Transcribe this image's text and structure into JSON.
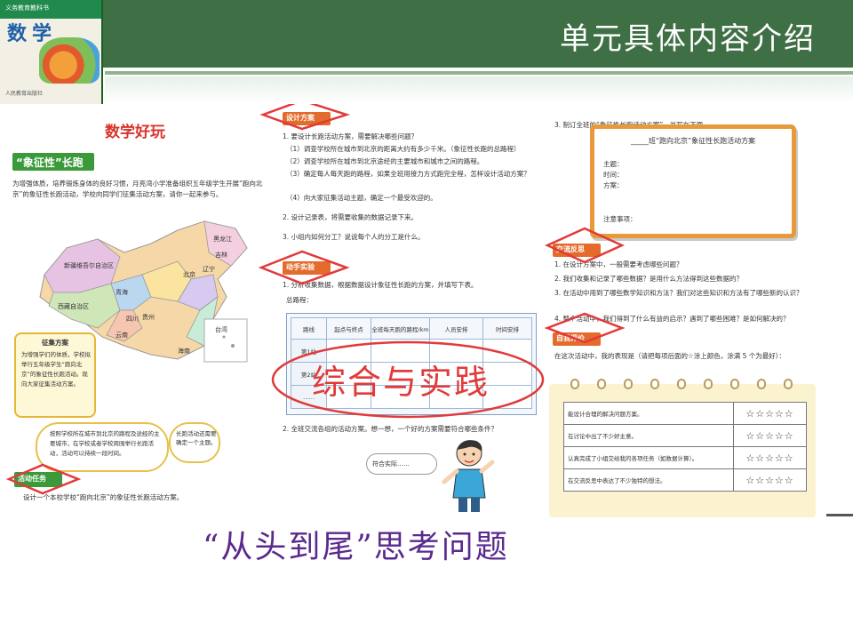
{
  "header": {
    "title": "单元具体内容介绍"
  },
  "cover": {
    "publisher_line": "义务教育教科书",
    "title": "数学",
    "bottom_line": "人民教育出版社"
  },
  "left_page": {
    "title": "数学好玩",
    "subtitle": "“象征性”长跑",
    "intro": "为增强体质，培养锻炼身体的良好习惯，月亮湾小学准备组织五年级学生开展“跑向北京”的象征性长跑活动，学校向同学们征集活动方案，请你一起来参与。",
    "map_labels": [
      "新疆维吾尔自治区",
      "西藏自治区",
      "青海",
      "四川",
      "云南",
      "贵州",
      "黑龙江",
      "吉林",
      "辽宁",
      "北京",
      "台湾",
      "海南"
    ],
    "note_title": "征集方案",
    "note_text": "为增强学们的体质，学校拟举行五年级学生“跑向北京”的象征性长跑活动。现向大家征集活动方案。",
    "cloud1_text": "按照学校所在城市到北京的路程及途经的主要城市，在学校或者学校周围举行长跑活动，活动可以持续一段时间。",
    "cloud2_text": "长跑活动还需要确定一个主题。",
    "task_label": "活动任务",
    "task_text": "设计一个本校学校“跑向北京”的象征性长跑活动方案。"
  },
  "middle_page": {
    "design_label": "设计方案",
    "design_items": [
      "1. 要设计长跑活动方案，需要解决哪些问题？",
      "（1）调查学校所在城市到北京的距离大约有多少千米。（象征性长跑的总路程）",
      "（2）调查学校所在城市到北京途经的主要城市和城市之间的路程。",
      "（3）确定每人每天跑的路程，如果全班用接力方式跑完全程，怎样设计活动方案？",
      "（4）向大家征集活动主题，确定一个最受欢迎的。",
      "2. 设计记录表，将需要收集的数据记录下来。",
      "3. 小组内如何分工？说说每个人的分工是什么。"
    ],
    "practice_label": "动手实验",
    "practice_items": [
      "1. 分析收集数据，根据数据设计象征性长跑的方案，并填写下表。",
      "总路程："
    ],
    "table": {
      "headers": [
        "路线",
        "起点与终点",
        "全班每天跑的路程/km",
        "人员安排",
        "时间安排"
      ],
      "rows": [
        [
          "第1站",
          "",
          "",
          "",
          ""
        ],
        [
          "第2站",
          "",
          "",
          "",
          ""
        ],
        [
          "……",
          "",
          "",
          "",
          ""
        ]
      ]
    },
    "question": "2. 全班交流各组的活动方案。想一想，一个好的方案需要符合哪些条件？",
    "bubble_text": "符合实际……"
  },
  "right_page": {
    "intro": "3. 制订全班的“象征性长跑活动方案”，并写在下面。",
    "plan_title": "_____班“跑向北京”象征性长跑活动方案",
    "plan_fields": [
      "主题：",
      "时间：",
      "方案："
    ],
    "plan_note": "注意事项：",
    "reflect_label": "交流反思",
    "reflect_items": [
      "1. 在设计方案中，一般需要考虑哪些问题？",
      "2. 我们收集和记录了哪些数据？是用什么方法得到这些数据的？",
      "3. 在活动中用到了哪些数学知识和方法？我们对这些知识和方法有了哪些新的认识？",
      "4. 整个活动中，我们得到了什么有益的启示？遇到了哪些困难？是如何解决的？"
    ],
    "eval_label": "自我评价",
    "eval_intro": "在这次活动中，我的表现是（请把每项后面的☆涂上颜色，涂满 5 个为最好）：",
    "eval_rows": [
      {
        "text": "能设计合理的解决问题方案。",
        "stars": "☆☆☆☆☆"
      },
      {
        "text": "在讨论中出了不少好主意。",
        "stars": "☆☆☆☆☆"
      },
      {
        "text": "认真完成了小组交给我的各项任务（如数据计算）。",
        "stars": "☆☆☆☆☆"
      },
      {
        "text": "在交流反思中表达了不少独特的想法。",
        "stars": "☆☆☆☆☆"
      }
    ]
  },
  "overlay": {
    "text": "综合与实践"
  },
  "caption": {
    "text": "“从头到尾”思考问题"
  },
  "colors": {
    "header_green": "#3f6f45",
    "highlight_red": "#e23a3a",
    "caption_purple": "#5a2a8c",
    "section_orange": "#e36b2c",
    "section_green": "#3a9a3a"
  }
}
